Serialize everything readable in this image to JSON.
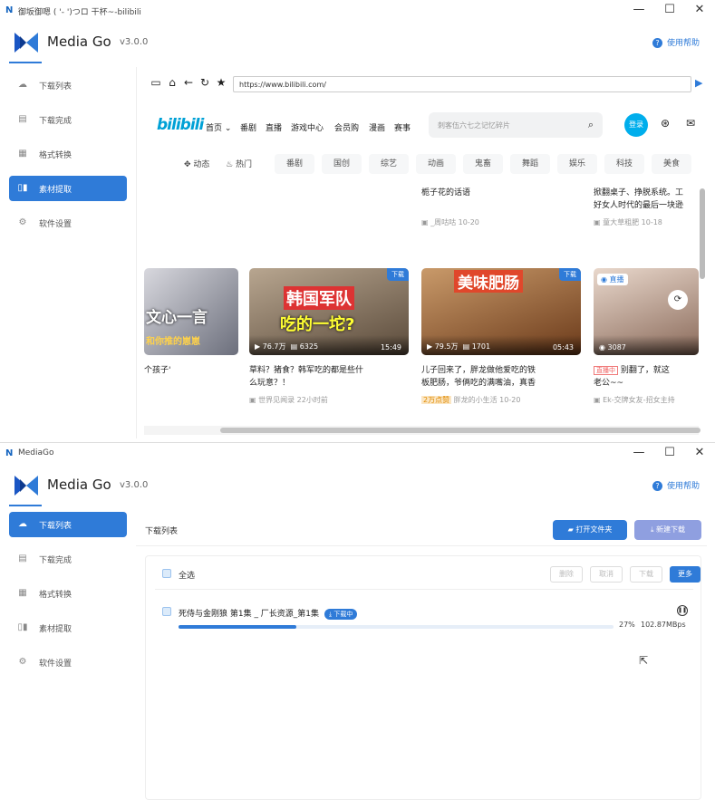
{
  "window1": {
    "title": "御坂御嗯 ( '- ')つロ 干杯~-bilibili",
    "controls": {
      "min": "—",
      "max": "☐",
      "close": "✕"
    },
    "app_name": "Media Go",
    "version": "v3.0.0",
    "help": "使用帮助",
    "sidebar": [
      {
        "label": "下载列表",
        "icon": "cloud-icon"
      },
      {
        "label": "下载完成",
        "icon": "check-doc-icon"
      },
      {
        "label": "格式转换",
        "icon": "convert-icon"
      },
      {
        "label": "素材提取",
        "icon": "extract-icon"
      },
      {
        "label": "软件设置",
        "icon": "gear-icon"
      }
    ],
    "active_index": 3,
    "browser": {
      "url": "https://www.bilibili.com/",
      "go": "▶",
      "site_logo": "bilibili",
      "nav": [
        "首页 ⌄",
        "番剧",
        "直播",
        "游戏中心",
        "会员购",
        "漫画",
        "赛事"
      ],
      "search_placeholder": "刺客伍六七之记忆碎片",
      "login": "登录",
      "top_links": [
        "动态",
        "热门"
      ],
      "categories": [
        "番剧",
        "国创",
        "综艺",
        "动画",
        "鬼畜",
        "舞蹈",
        "娱乐",
        "科技",
        "美食"
      ],
      "feed_top": [
        {
          "title": "栀子花的话语",
          "meta": "_周咕咕  10-20"
        },
        {
          "title": "掀翻桌子、挣脱系统。工\n好女人时代的最后一块逊",
          "meta": "童大草粗肥  10-18"
        }
      ],
      "cards": [
        {
          "overlay": "文心一言",
          "overlay2": "和你推的崽崽",
          "title": "个孩子'"
        },
        {
          "overlay": "韩国军队",
          "overlay2": "吃的一坨?",
          "tag": "下载",
          "views": "76.7万",
          "danmaku": "6325",
          "duration": "15:49",
          "title": "草料？猪食？韩军吃的都是些什\n么玩意？！",
          "meta": "世界见闻录  22小时前"
        },
        {
          "overlay": "美味肥肠",
          "tag": "下载",
          "views": "79.5万",
          "danmaku": "1701",
          "duration": "05:43",
          "title": "儿子回来了，胖龙做他爱吃的铁\n板肥肠，爷俩吃的满嘴油，真香",
          "meta": "胖龙的小生活  10-20",
          "badge": "2万点赞"
        },
        {
          "live": "直播",
          "views": "3087",
          "title": "别翻了，就这\n老公~~",
          "live_tag": "直播中",
          "meta": "Ek-交牌女友-招女主持"
        }
      ]
    }
  },
  "window2": {
    "title": "MediaGo",
    "controls": {
      "min": "—",
      "max": "☐",
      "close": "✕"
    },
    "app_name": "Media Go",
    "version": "v3.0.0",
    "help": "使用帮助",
    "sidebar": [
      {
        "label": "下载列表",
        "icon": "cloud-icon"
      },
      {
        "label": "下载完成",
        "icon": "check-doc-icon"
      },
      {
        "label": "格式转换",
        "icon": "convert-icon"
      },
      {
        "label": "素材提取",
        "icon": "extract-icon"
      },
      {
        "label": "软件设置",
        "icon": "gear-icon"
      }
    ],
    "active_index": 0,
    "panel_title": "下载列表",
    "open_folder": "打开文件夹",
    "new_download": "新建下载",
    "select_all": "全选",
    "actions": [
      "删除",
      "取消",
      "下载"
    ],
    "more": "更多",
    "item": {
      "title": "死侍与金刚狼 第1集 _ 厂长资源_第1集",
      "status": "下载中",
      "progress": 0.27,
      "percent": "27%",
      "speed": "102.87MBps"
    }
  }
}
